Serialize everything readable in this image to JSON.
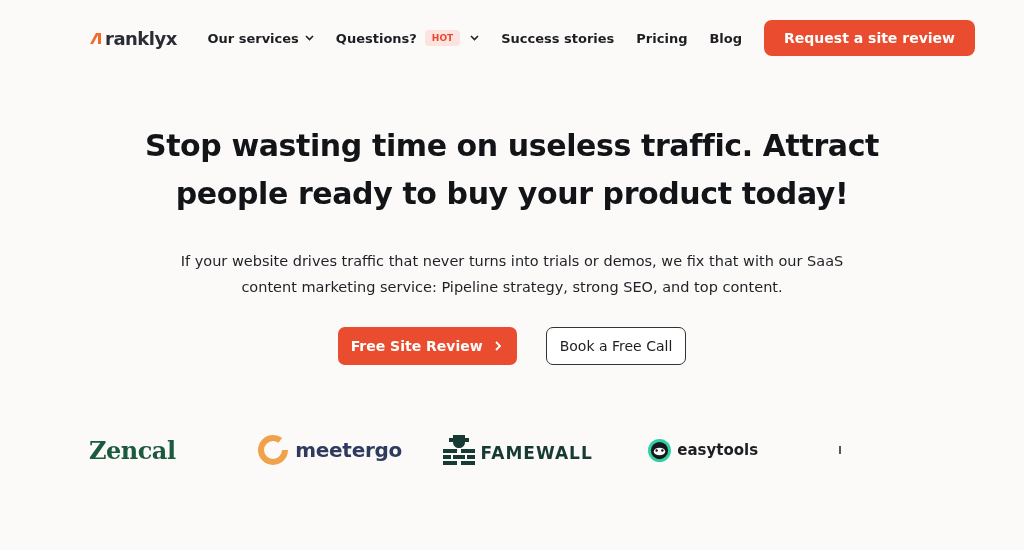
{
  "brand": {
    "name": "ranklyx"
  },
  "nav": [
    {
      "label": "Our services",
      "dropdown": true
    },
    {
      "label": "Questions?",
      "badge": "HOT",
      "dropdown": true
    },
    {
      "label": "Success stories",
      "dropdown": false
    },
    {
      "label": "Pricing",
      "dropdown": false
    },
    {
      "label": "Blog",
      "dropdown": false
    }
  ],
  "header_button": "Request a site review",
  "hero": {
    "title": "Stop wasting time on useless traffic. Attract people ready to buy your product today!",
    "subtitle": "If your website drives traffic that never turns into trials or demos, we fix that with our SaaS content marketing service: Pipeline strategy, strong SEO, and top content.",
    "buttons": [
      {
        "label": "Free Site Review",
        "kind": "primary"
      },
      {
        "label": "Book a Free Call",
        "kind": "secondary"
      }
    ]
  },
  "logos": [
    {
      "name": "Zencal",
      "kind": "serif"
    },
    {
      "name": "meetergo",
      "kind": "ring"
    },
    {
      "name": "FAMEWALL",
      "kind": "trophy"
    },
    {
      "name": "easytools",
      "kind": "badge"
    },
    {
      "kind": "partial"
    }
  ]
}
